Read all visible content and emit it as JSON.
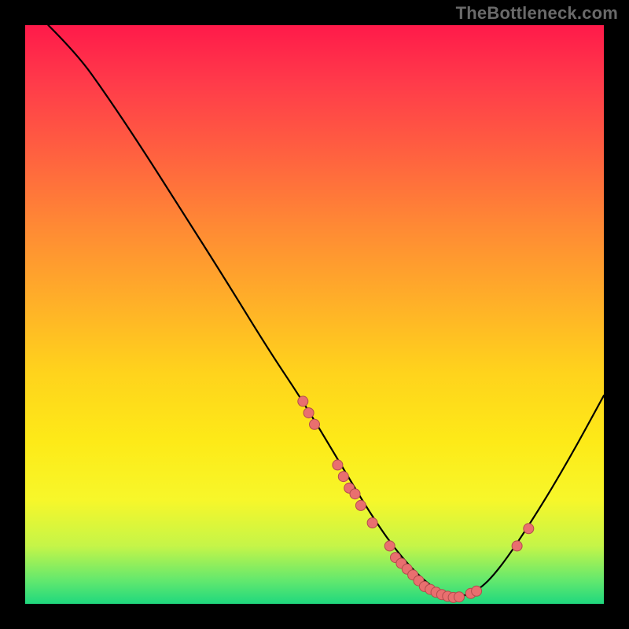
{
  "attribution": "TheBottleneck.com",
  "chart_data": {
    "type": "line",
    "title": "",
    "xlabel": "",
    "ylabel": "",
    "xlim": [
      0,
      100
    ],
    "ylim": [
      0,
      100
    ],
    "grid": false,
    "legend": false,
    "curve": [
      {
        "x": 4,
        "y": 100
      },
      {
        "x": 9,
        "y": 95
      },
      {
        "x": 14,
        "y": 88
      },
      {
        "x": 20,
        "y": 79
      },
      {
        "x": 27,
        "y": 68
      },
      {
        "x": 34,
        "y": 57
      },
      {
        "x": 42,
        "y": 44
      },
      {
        "x": 48,
        "y": 35
      },
      {
        "x": 54,
        "y": 25
      },
      {
        "x": 60,
        "y": 15
      },
      {
        "x": 65,
        "y": 8
      },
      {
        "x": 70,
        "y": 3
      },
      {
        "x": 74,
        "y": 1
      },
      {
        "x": 78,
        "y": 2
      },
      {
        "x": 82,
        "y": 6
      },
      {
        "x": 88,
        "y": 15
      },
      {
        "x": 94,
        "y": 25
      },
      {
        "x": 100,
        "y": 36
      }
    ],
    "points": [
      {
        "x": 48,
        "y": 35
      },
      {
        "x": 49,
        "y": 33
      },
      {
        "x": 50,
        "y": 31
      },
      {
        "x": 54,
        "y": 24
      },
      {
        "x": 55,
        "y": 22
      },
      {
        "x": 56,
        "y": 20
      },
      {
        "x": 57,
        "y": 19
      },
      {
        "x": 58,
        "y": 17
      },
      {
        "x": 60,
        "y": 14
      },
      {
        "x": 63,
        "y": 10
      },
      {
        "x": 64,
        "y": 8
      },
      {
        "x": 65,
        "y": 7
      },
      {
        "x": 66,
        "y": 6
      },
      {
        "x": 67,
        "y": 5
      },
      {
        "x": 68,
        "y": 4
      },
      {
        "x": 69,
        "y": 3
      },
      {
        "x": 70,
        "y": 2.5
      },
      {
        "x": 71,
        "y": 2
      },
      {
        "x": 72,
        "y": 1.6
      },
      {
        "x": 73,
        "y": 1.3
      },
      {
        "x": 74,
        "y": 1.1
      },
      {
        "x": 75,
        "y": 1.2
      },
      {
        "x": 77,
        "y": 1.8
      },
      {
        "x": 78,
        "y": 2.2
      },
      {
        "x": 85,
        "y": 10
      },
      {
        "x": 87,
        "y": 13
      }
    ]
  }
}
